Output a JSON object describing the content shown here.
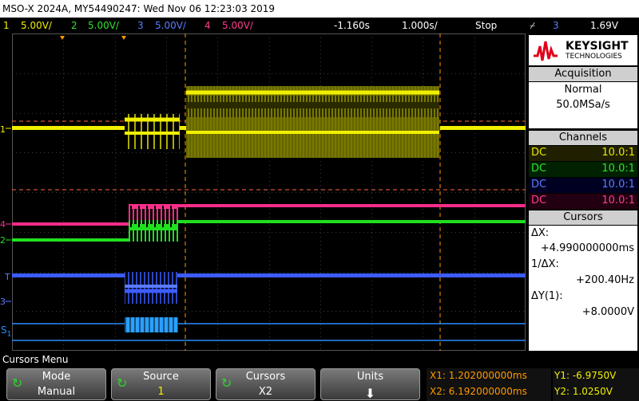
{
  "title": "MSO-X 2024A, MY54490247: Wed Nov 06 12:23:03 2019",
  "channels_bar": {
    "ch1": {
      "num": "1",
      "scale": "5.00V/",
      "color": "#f0f000"
    },
    "ch2": {
      "num": "2",
      "scale": "5.00V/",
      "color": "#30e030"
    },
    "ch3": {
      "num": "3",
      "scale": "5.00V/",
      "color": "#5b7cff"
    },
    "ch4": {
      "num": "4",
      "scale": "5.00V/",
      "color": "#ff3d8f"
    },
    "delay": "-1.160s",
    "timebase": "1.000s/",
    "run_state": "Stop",
    "trigger_icon": "trigger-edge-icon",
    "trigger_source": "3",
    "trigger_level": "1.69V"
  },
  "logo": {
    "brand": "KEYSIGHT",
    "sub": "TECHNOLOGIES"
  },
  "acquisition": {
    "header": "Acquisition",
    "mode": "Normal",
    "rate": "50.0MSa/s"
  },
  "channels": {
    "header": "Channels",
    "rows": [
      {
        "coupling": "DC",
        "probe": "10.0:1",
        "color": "#e8e800"
      },
      {
        "coupling": "DC",
        "probe": "10.0:1",
        "color": "#30e030"
      },
      {
        "coupling": "DC",
        "probe": "10.0:1",
        "color": "#5b7cff"
      },
      {
        "coupling": "DC",
        "probe": "10.0:1",
        "color": "#ff3d8f"
      }
    ]
  },
  "cursors": {
    "header": "Cursors",
    "dx_label": "ΔX:",
    "dx_value": "+4.990000000ms",
    "inv_dx_label": "1/ΔX:",
    "inv_dx_value": "+200.40Hz",
    "dy_label": "ΔY(1):",
    "dy_value": "+8.0000V"
  },
  "menu": {
    "title": "Cursors Menu"
  },
  "softkeys": [
    {
      "top": "Mode",
      "bottom": "Manual",
      "icon": "refresh-icon"
    },
    {
      "top": "Source",
      "bottom": "1",
      "icon": "refresh-icon"
    },
    {
      "top": "Cursors",
      "bottom": "X2",
      "icon": "refresh-icon"
    },
    {
      "top": "Units",
      "bottom": "",
      "icon": "down-arrow-icon"
    }
  ],
  "readouts": {
    "x1": "X1: 1.202000000ms",
    "x2": "X2: 6.192000000ms",
    "y1": "Y1: -6.9750V",
    "y2": "Y2: 1.0250V"
  },
  "markers": {
    "s1": "S",
    "s1_sub": "1"
  }
}
